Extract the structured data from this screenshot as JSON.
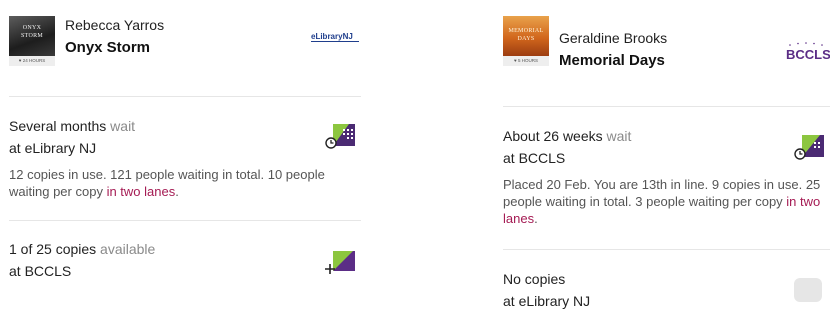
{
  "left": {
    "book": {
      "author": "Rebecca Yarros",
      "title": "Onyx Storm",
      "cover_text": [
        "ONYX",
        "STORM"
      ],
      "cover_tag": "24 HOURS",
      "library_logo": "eLibraryNJ"
    },
    "availability": [
      {
        "status_value": "Several months",
        "status_suffix": " wait",
        "library_prefix": "at ",
        "library": "eLibrary NJ",
        "detail_text": "12 copies in use. 121 people waiting in total. 10 people waiting per copy ",
        "detail_link": "in two lanes",
        "detail_end": ".",
        "icon": "hold-wait-icon"
      },
      {
        "status_value": "1 of 25 copies",
        "status_suffix": " available",
        "library_prefix": "at ",
        "library": "BCCLS",
        "icon": "borrow-plus-icon"
      }
    ]
  },
  "right": {
    "book": {
      "author": "Geraldine Brooks",
      "title": "Memorial Days",
      "cover_text": [
        "MEMORIAL",
        "DAYS"
      ],
      "cover_tag": "5 HOURS",
      "library_logo": "BCCLS"
    },
    "availability": [
      {
        "status_value": "About 26 weeks",
        "status_suffix": " wait",
        "library_prefix": "at ",
        "library": "BCCLS",
        "detail_text": "Placed 20 Feb. You are 13th in line. 9 copies in use. 25 people waiting in total. 3 people waiting per copy ",
        "detail_link": "in two lanes",
        "detail_end": ".",
        "icon": "hold-wait-icon"
      },
      {
        "status_value": "No copies",
        "status_suffix": "",
        "library_prefix": "at ",
        "library": "eLibrary NJ",
        "icon": "unavailable-icon"
      }
    ]
  },
  "colors": {
    "link": "#a51c54",
    "hold_green": "#8cc63f",
    "hold_purple": "#4b2a73",
    "borrow_purple": "#5b2d86"
  }
}
